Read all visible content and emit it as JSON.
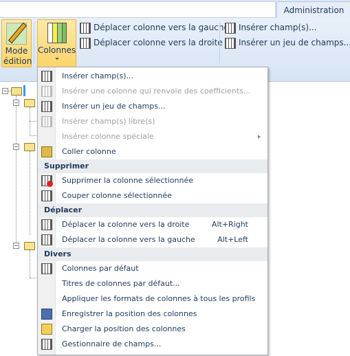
{
  "tab": "Administration",
  "ribbon": {
    "mode_edition": "Mode édition",
    "colonnes": "Colonnes",
    "move_left": "Déplacer colonne vers la gauche",
    "move_right": "Déplacer colonne vers la droite",
    "insert_fields": "Insérer champ(s)...",
    "insert_fieldset": "Insérer un jeu de champs..."
  },
  "menu": {
    "items": [
      {
        "label": "Insérer champ(s)...",
        "enabled": true,
        "icon": "insert-field-icon"
      },
      {
        "label": "Insérer une colonne qui renvoie des coefficients...",
        "enabled": false,
        "icon": "coefficient-icon"
      },
      {
        "label": "Insérer un jeu de champs...",
        "enabled": true,
        "icon": "insert-fieldset-icon"
      },
      {
        "label": "Insérer champ(s) libre(s)",
        "enabled": false,
        "icon": "free-field-icon"
      },
      {
        "label": "Insérer colonne spéciale",
        "enabled": false
      },
      {
        "label": "Coller colonne",
        "enabled": true,
        "icon": "paste-icon"
      }
    ],
    "sections": {
      "supprimer": {
        "title": "Supprimer",
        "items": [
          {
            "label": "Supprimer la colonne sélectionnée",
            "icon": "delete-column-icon"
          },
          {
            "label": "Couper colonne sélectionnée",
            "icon": "cut-icon"
          }
        ]
      },
      "deplacer": {
        "title": "Déplacer",
        "items": [
          {
            "label": "Déplacer la colonne vers la droite",
            "shortcut": "Alt+Right",
            "icon": "move-right-icon"
          },
          {
            "label": "Déplacer la colonne vers la gauche",
            "shortcut": "Alt+Left",
            "icon": "move-left-icon"
          }
        ]
      },
      "divers": {
        "title": "Divers",
        "items": [
          {
            "label": "Colonnes par défaut",
            "icon": "default-columns-icon"
          },
          {
            "label": "Titres de colonnes par défaut..."
          },
          {
            "label": "Appliquer les formats de colonnes à tous les profils"
          },
          {
            "label": "Enregistrer la position des colonnes",
            "icon": "save-icon"
          },
          {
            "label": "Charger la position des colonnes",
            "icon": "load-icon"
          },
          {
            "label": "Gestionnaire de champs...",
            "icon": "field-manager-icon"
          }
        ]
      }
    }
  }
}
